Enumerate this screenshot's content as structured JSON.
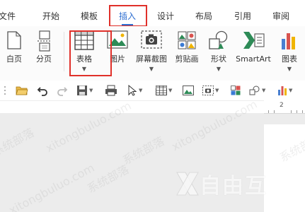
{
  "tabs": [
    {
      "label": "文件",
      "active": false
    },
    {
      "label": "开始",
      "active": false
    },
    {
      "label": "模板",
      "active": false
    },
    {
      "label": "插入",
      "active": true
    },
    {
      "label": "设计",
      "active": false
    },
    {
      "label": "布局",
      "active": false
    },
    {
      "label": "引用",
      "active": false
    },
    {
      "label": "审阅",
      "active": false
    }
  ],
  "ribbon": {
    "blank_page": "白页",
    "page_break": "分页",
    "table": "表格",
    "picture": "图片",
    "screenshot": "屏幕截图",
    "clipart": "剪贴画",
    "shapes": "形状",
    "smartart": "SmartArt",
    "chart": "图表"
  },
  "ruler": {
    "mark": "2"
  },
  "watermarks": {
    "site_cn": "系统部落",
    "site_url": "xitongbuluo.com",
    "logo_text": "自由互"
  },
  "colors": {
    "accent": "#2f6fd1",
    "highlight_box": "#e0302a",
    "workspace": "#ececec"
  }
}
